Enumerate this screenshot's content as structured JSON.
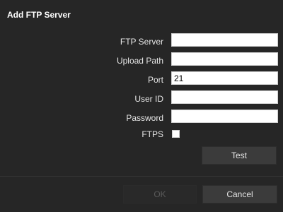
{
  "dialog": {
    "title": "Add FTP Server"
  },
  "form": {
    "ftp_server": {
      "label": "FTP Server",
      "value": ""
    },
    "upload_path": {
      "label": "Upload Path",
      "value": ""
    },
    "port": {
      "label": "Port",
      "value": "21"
    },
    "user_id": {
      "label": "User ID",
      "value": ""
    },
    "password": {
      "label": "Password",
      "value": ""
    },
    "ftps": {
      "label": "FTPS",
      "checked": false
    }
  },
  "buttons": {
    "test": "Test",
    "ok": "OK",
    "ok_disabled": true,
    "cancel": "Cancel"
  },
  "colors": {
    "background": "#262626",
    "button_bg": "#3b3b3b",
    "text": "#e6e6e6"
  }
}
